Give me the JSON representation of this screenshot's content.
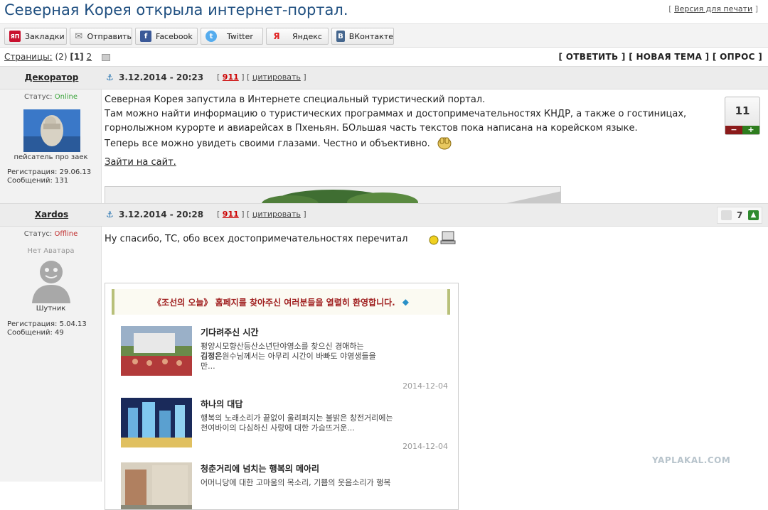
{
  "page": {
    "title": "Северная Корея открыла интернет-портал.",
    "print_bracket_open": "[",
    "print_link": "Версия для печати",
    "print_bracket_close": "]"
  },
  "share": [
    {
      "label": "Закладки",
      "icon": "yaplakal-bookmark-icon",
      "glyph": "ЯП",
      "color": "#c8102e"
    },
    {
      "label": "Отправить",
      "icon": "envelope-icon",
      "glyph": "✉",
      "color": "#777777"
    },
    {
      "label": "Facebook",
      "icon": "facebook-icon",
      "glyph": "f",
      "color": "#3b5998"
    },
    {
      "label": "Twitter",
      "icon": "twitter-icon",
      "glyph": "t",
      "color": "#55acee"
    },
    {
      "label": "Яндекс",
      "icon": "yandex-icon",
      "glyph": "Я",
      "color": "#e02020"
    },
    {
      "label": "ВКонтакте",
      "icon": "vk-icon",
      "glyph": "B",
      "color": "#45668e"
    }
  ],
  "pager": {
    "label": "Страницы:",
    "count": "(2)",
    "current": "[1]",
    "page2": "2"
  },
  "actions": {
    "reply": "[ ОТВЕТИТЬ ]",
    "new_topic": "[ НОВАЯ ТЕМА ]",
    "poll": "[ ОПРОС ]"
  },
  "posts": [
    {
      "author": "Декоратор",
      "date": "3.12.2014 - 20:23",
      "bracket_open": "[",
      "num": "911",
      "bracket_mid": "] [",
      "cite": "цитировать",
      "bracket_close": "]",
      "status_label": "Статус:",
      "status": "Online",
      "rank": "пейсатель про заек",
      "reg": "Регистрация: 29.06.13",
      "messages": "Сообщений: 131",
      "rating": "11",
      "text_lines": [
        "Северная Корея запустила в Интернете специальный туристический портал.",
        "Там можно найти информацию о туристических программах и достопримечательностях КНДР, а также о гостиницах,",
        "горнолыжном курорте и авиарейсах в Пхеньян. БОльшая часть текстов пока написана на корейском языке.",
        "Теперь все можно увидеть своими глазами. Честно и объективно."
      ],
      "link": "Зайти на сайт."
    },
    {
      "author": "Xardos",
      "date": "3.12.2014 - 20:28",
      "bracket_open": "[",
      "num": "911",
      "bracket_mid": "] [",
      "cite": "цитировать",
      "bracket_close": "]",
      "status_label": "Статус:",
      "status": "Offline",
      "avatar_label": "Нет Аватара",
      "rank": "Шутник",
      "reg": "Регистрация: 5.04.13",
      "messages": "Сообщений: 49",
      "rating": "7",
      "text": "Ну спасибо, ТС, обо всех достопримечательностях перечитал"
    }
  ],
  "embed": {
    "banner": "《조선의 오늘》 홈페지를 찾아주신 여러분들을 열렬히 환영합니다.",
    "items": [
      {
        "title": "기다려주신 시간",
        "text_1": "평양시모향산등산소년단야영소를 찾으신 경애하는",
        "text_2_bold": "김정은",
        "text_2": "원수님께서는 아무리 시간이 바빠도 야영생들을",
        "text_3": "만...",
        "date": "2014-12-04"
      },
      {
        "title": "하나의 대답",
        "text_1": "행복의 노래소리가 끝없이 울려퍼지는 불밝은 창전거리에는",
        "text_2": "천여바이의 다심하신 사랑에 대한 가슴뜨거운...",
        "date": "2014-12-04"
      },
      {
        "title": "청춘거리에 넘치는 행복의 메아리",
        "text_1": "어머니당에 대한 고마움의 목소리, 기쁨의 웃음소리가 행복"
      }
    ]
  },
  "watermark": "YAPLAKAL.COM"
}
